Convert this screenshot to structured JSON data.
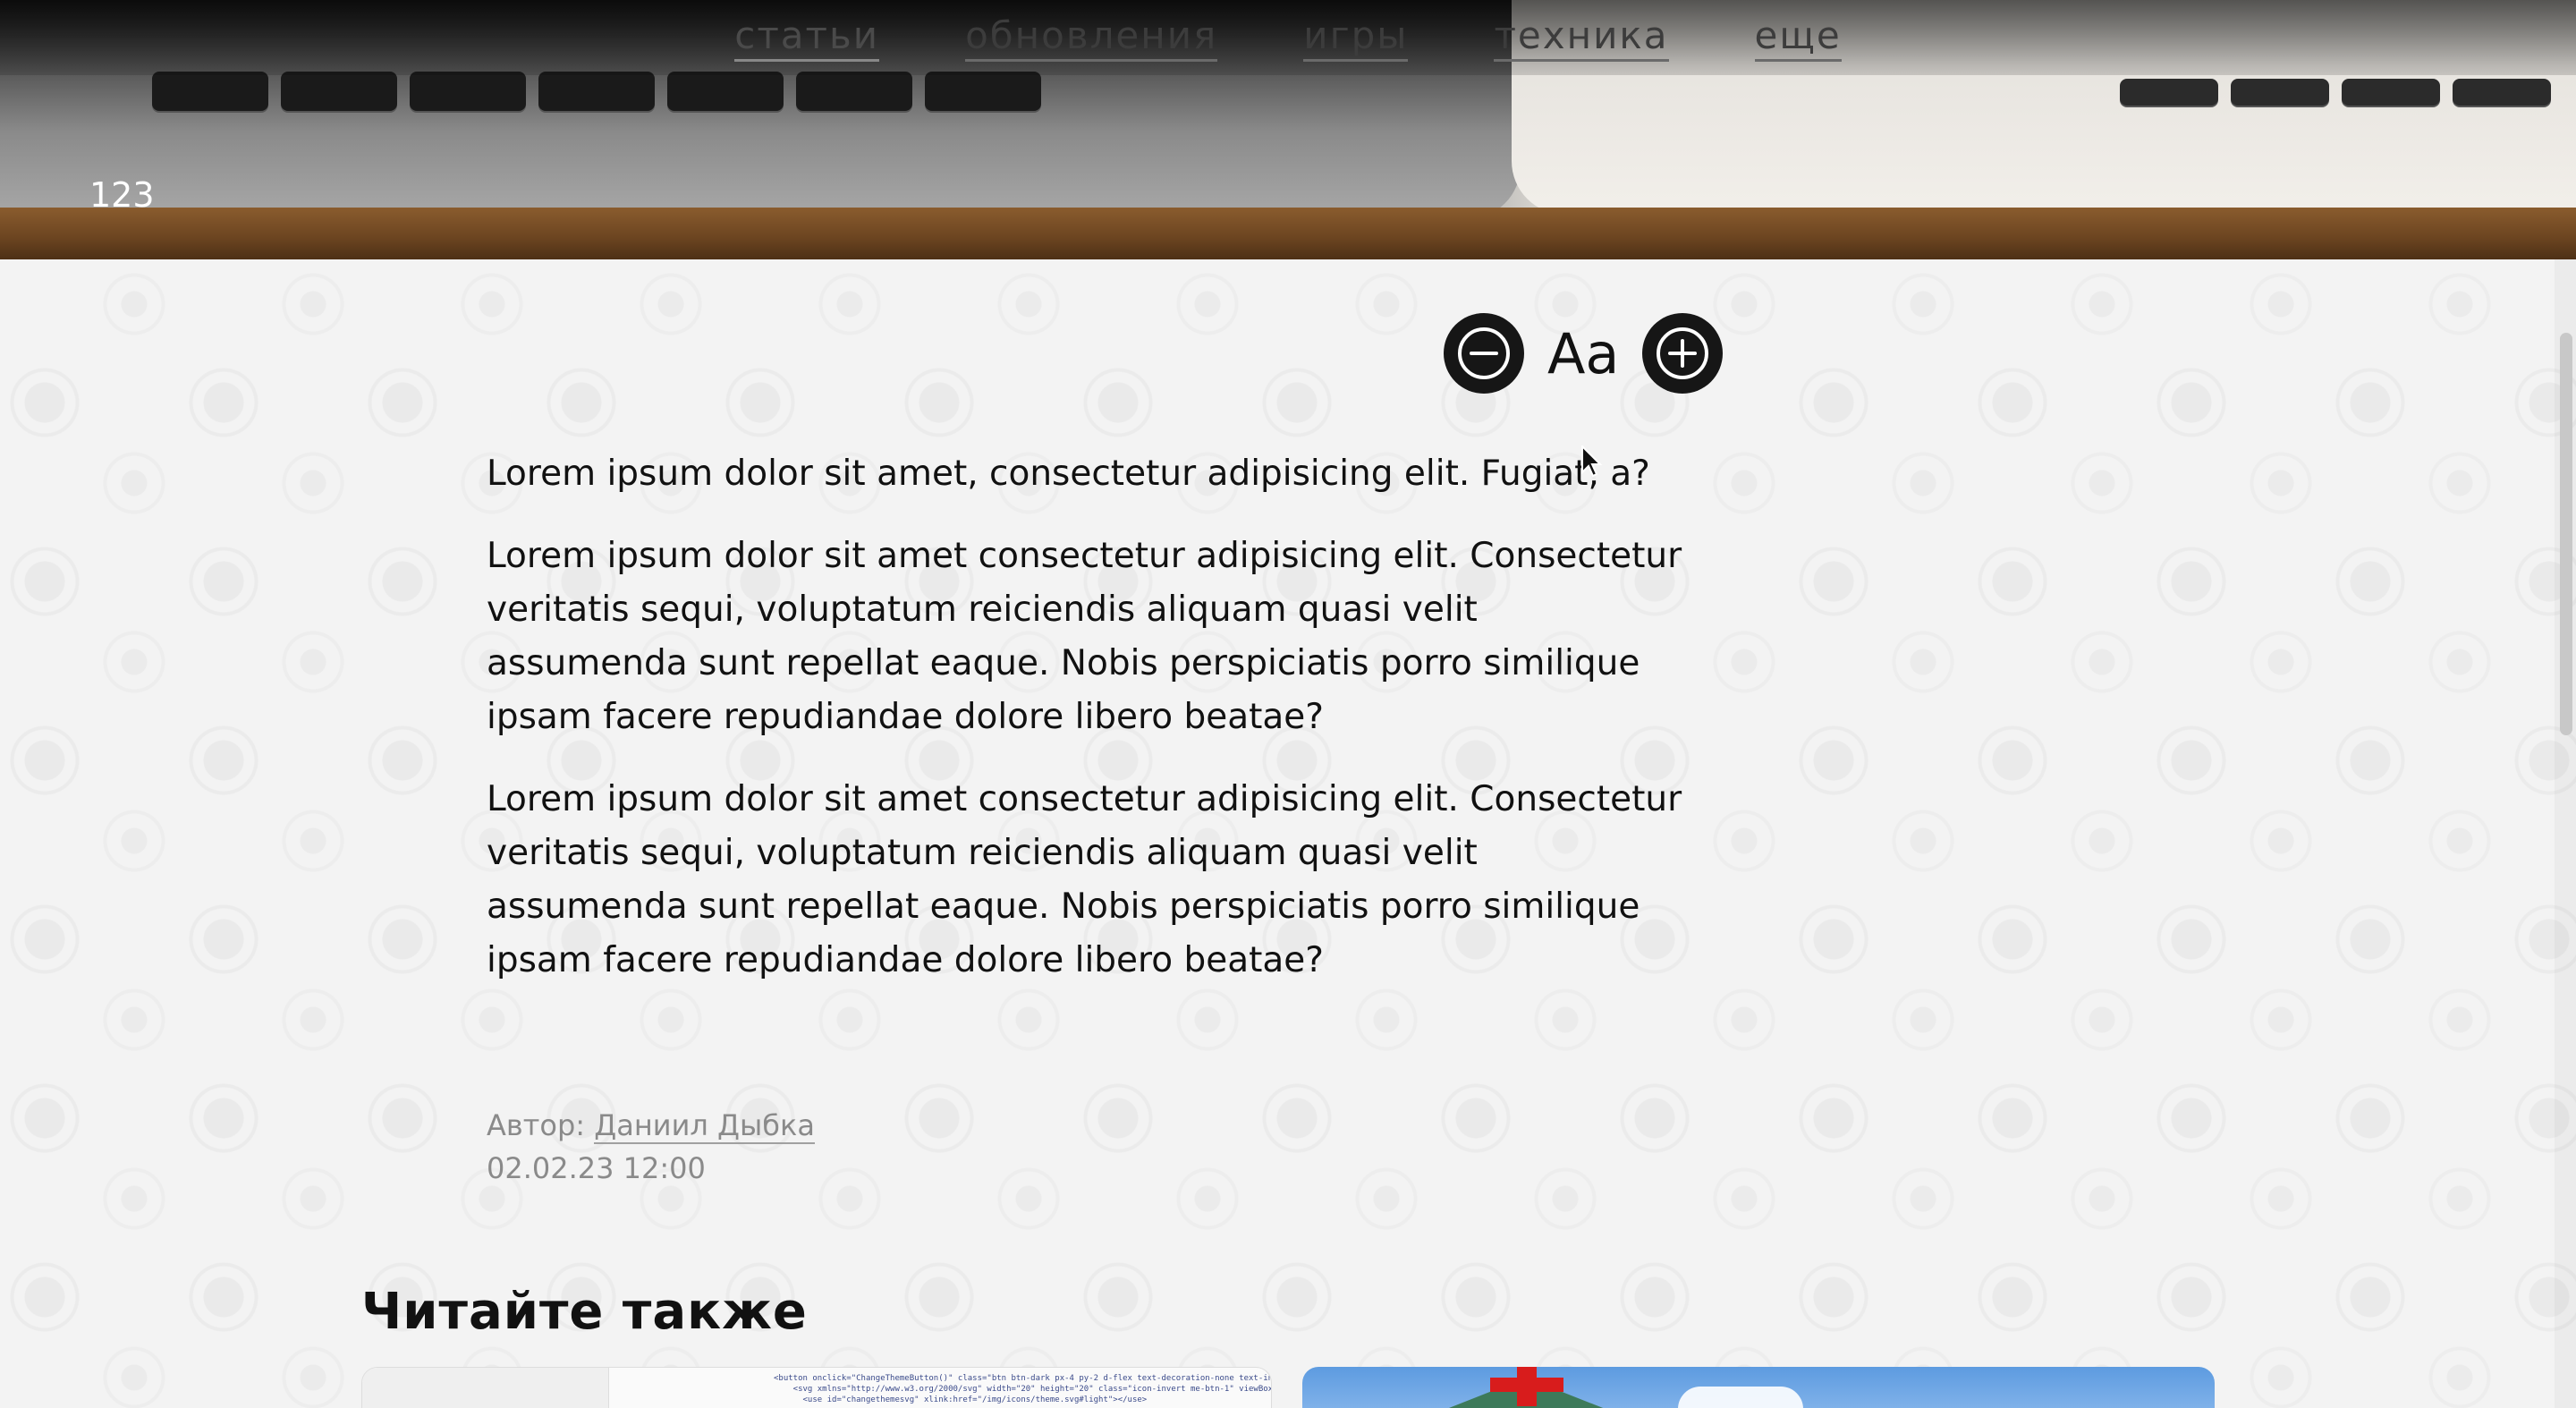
{
  "nav": {
    "items": [
      {
        "label": "статьи",
        "active": true
      },
      {
        "label": "обновления",
        "active": false
      },
      {
        "label": "игры",
        "active": false
      },
      {
        "label": "техника",
        "active": false
      },
      {
        "label": "еще",
        "active": false
      }
    ]
  },
  "hero": {
    "number": "123"
  },
  "font_controls": {
    "label": "Aa",
    "decrease_icon": "minus-circle-icon",
    "increase_icon": "plus-circle-icon"
  },
  "article": {
    "paragraphs": [
      "Lorem ipsum dolor sit amet, consectetur adipisicing elit. Fugiat, a?",
      "Lorem ipsum dolor sit amet consectetur adipisicing elit. Consectetur veritatis sequi, voluptatum reiciendis aliquam quasi velit assumenda sunt repellat eaque. Nobis perspiciatis porro similique ipsam facere repudiandae dolore libero beatae?",
      "Lorem ipsum dolor sit amet consectetur adipisicing elit. Consectetur veritatis sequi, voluptatum reiciendis aliquam quasi velit assumenda sunt repellat eaque. Nobis perspiciatis porro similique ipsam facere repudiandae dolore libero beatae?"
    ]
  },
  "meta": {
    "author_label": "Автор:",
    "author_name": "Даниил Дыбка",
    "date": "02.02.23 12:00"
  },
  "read_also": {
    "title": "Читайте также"
  },
  "colors": {
    "background": "#f3f3f3",
    "button": "#161616",
    "meta_text": "#8a8a8a"
  }
}
